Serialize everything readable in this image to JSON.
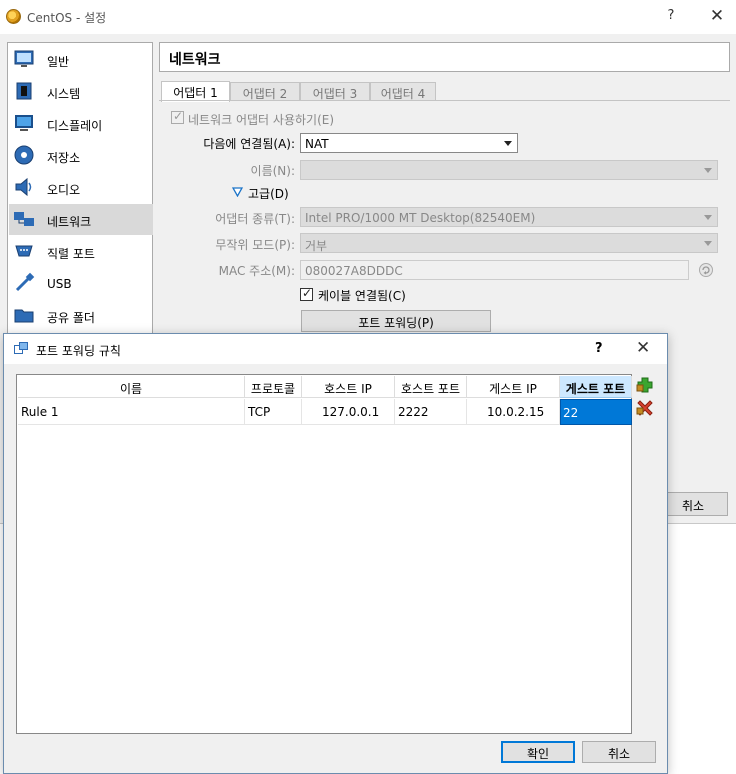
{
  "main_window": {
    "title": "CentOS - 설정",
    "help_label": "?",
    "close_label": "✕",
    "sidebar": {
      "items": [
        {
          "label": "일반",
          "icon": "general-icon"
        },
        {
          "label": "시스템",
          "icon": "system-icon"
        },
        {
          "label": "디스플레이",
          "icon": "display-icon"
        },
        {
          "label": "저장소",
          "icon": "storage-icon"
        },
        {
          "label": "오디오",
          "icon": "audio-icon"
        },
        {
          "label": "네트워크",
          "icon": "network-icon",
          "selected": true
        },
        {
          "label": "직렬 포트",
          "icon": "serial-port-icon"
        },
        {
          "label": "USB",
          "icon": "usb-icon"
        },
        {
          "label": "공유 폴더",
          "icon": "shared-folder-icon"
        }
      ]
    },
    "page_title": "네트워크",
    "tabs": [
      "어댑터 1",
      "어댑터 2",
      "어댑터 3",
      "어댑터 4"
    ],
    "active_tab": 0,
    "adapter": {
      "enable_label": "네트워크 어댑터 사용하기(E)",
      "enable_checked": true,
      "attached_label": "다음에 연결됨(A):",
      "attached_value": "NAT",
      "name_label": "이름(N):",
      "name_value": "",
      "advanced_label": "고급(D)",
      "adapter_type_label": "어댑터 종류(T):",
      "adapter_type_value": "Intel PRO/1000 MT Desktop(82540EM)",
      "promisc_label": "무작위 모드(P):",
      "promisc_value": "거부",
      "mac_label": "MAC 주소(M):",
      "mac_value": "080027A8DDDC",
      "cable_label": "케이블 연결됨(C)",
      "cable_checked": true,
      "port_forward_button": "포트 포워딩(P)"
    },
    "cancel_button": "취소"
  },
  "dialog": {
    "title": "포트 포워딩 규칙",
    "help_label": "?",
    "close_label": "✕",
    "columns": [
      "이름",
      "프로토콜",
      "호스트 IP",
      "호스트 포트",
      "게스트 IP",
      "게스트 포트"
    ],
    "sorted_column": 5,
    "rows": [
      [
        "Rule 1",
        "TCP",
        "127.0.0.1",
        "2222",
        "10.0.2.15",
        "22"
      ]
    ],
    "ok_button": "확인",
    "cancel_button": "취소",
    "colors": {
      "add": "#3aa630",
      "remove": "#d9432f",
      "selection": "#0078d7"
    }
  }
}
